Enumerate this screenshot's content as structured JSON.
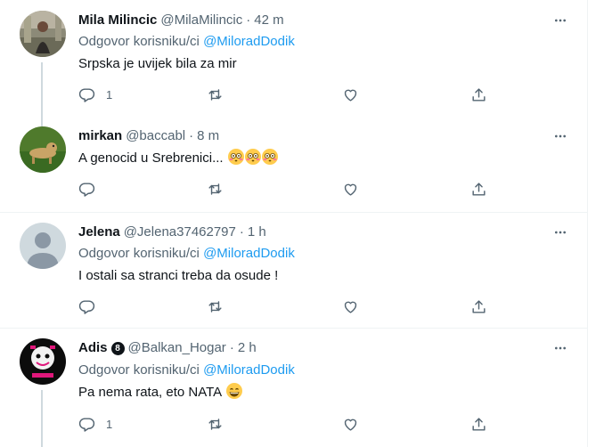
{
  "tweets": [
    {
      "name": "Mila Milincic",
      "handle": "@MilaMilincic",
      "time": "42 m",
      "reply_prefix": "Odgovor korisniku/ci",
      "reply_to": "@MiloradDodik",
      "text": "Srpska je uvijek bila za mir",
      "reply_count": "1"
    },
    {
      "name": "mirkan",
      "handle": "@baccabl",
      "time": "8 m",
      "text": "A genocid u Srebrenici...",
      "emojis": [
        "flushed-face",
        "flushed-face",
        "flushed-face"
      ]
    },
    {
      "name": "Jelena",
      "handle": "@Jelena37462797",
      "time": "1 h",
      "reply_prefix": "Odgovor korisniku/ci",
      "reply_to": "@MiloradDodik",
      "text": "I ostali sa stranci treba da osude !"
    },
    {
      "name": "Adis",
      "badge": "8",
      "handle": "@Balkan_Hogar",
      "time": "2 h",
      "reply_prefix": "Odgovor korisniku/ci",
      "reply_to": "@MiloradDodik",
      "text": "Pa nema rata, eto NATA",
      "emojis": [
        "grinning-face"
      ],
      "reply_count": "1"
    }
  ],
  "separator": "·",
  "colors": {
    "text": "#0f1419",
    "secondary": "#536471",
    "link": "#1d9bf0",
    "border": "#eff3f4",
    "thread": "#cfd9de"
  },
  "icons": [
    "reply-icon",
    "retweet-icon",
    "like-icon",
    "share-icon",
    "more-icon"
  ]
}
